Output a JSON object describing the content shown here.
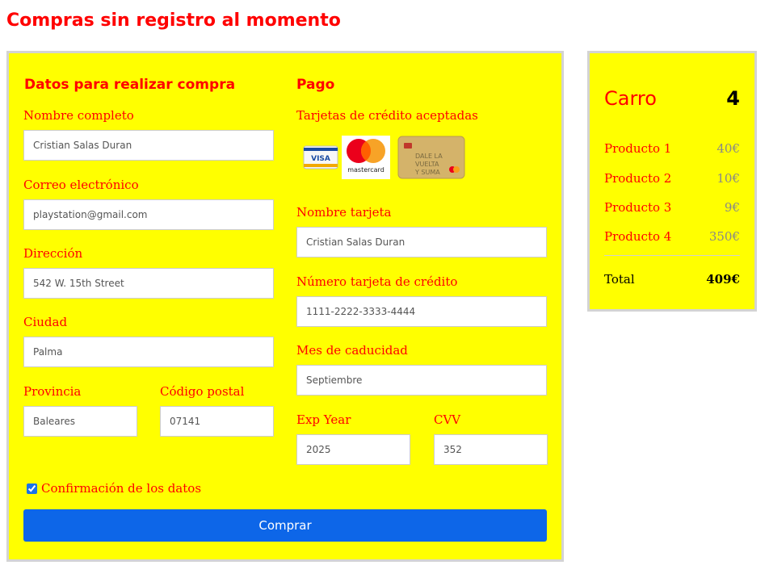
{
  "page": {
    "title": "Compras sin registro al momento"
  },
  "billing": {
    "heading": "Datos para realizar compra",
    "name_label": "Nombre completo",
    "name_value": "Cristian Salas Duran",
    "email_label": "Correo electrónico",
    "email_value": "playstation@gmail.com",
    "address_label": "Dirección",
    "address_value": "542 W. 15th Street",
    "city_label": "Ciudad",
    "city_value": "Palma",
    "province_label": "Provincia",
    "province_value": "Baleares",
    "zip_label": "Código postal",
    "zip_value": "07141"
  },
  "payment": {
    "heading": "Pago",
    "cards_label": "Tarjetas de crédito aceptadas",
    "card_icons": [
      "visa-card-icon",
      "mastercard-card-icon",
      "gold-card-icon"
    ],
    "card_texts": {
      "visa": "VISA",
      "mastercard": "mastercard",
      "gold_line1": "DALE LA",
      "gold_line2": "VUELTA",
      "gold_line3": "Y SUMA"
    },
    "card_name_label": "Nombre tarjeta",
    "card_name_value": "Cristian Salas Duran",
    "card_number_label": "Número tarjeta de crédito",
    "card_number_value": "1111-2222-3333-4444",
    "exp_month_label": "Mes de caducidad",
    "exp_month_value": "Septiembre",
    "exp_year_label": "Exp Year",
    "exp_year_value": "2025",
    "cvv_label": "CVV",
    "cvv_value": "352"
  },
  "confirm": {
    "label": "Confirmación de los datos",
    "checked": true
  },
  "submit": {
    "label": "Comprar"
  },
  "cart": {
    "title": "Carro",
    "count": "4",
    "items": [
      {
        "name": "Producto 1",
        "price": "40€"
      },
      {
        "name": "Producto 2",
        "price": "10€"
      },
      {
        "name": "Producto 3",
        "price": "9€"
      },
      {
        "name": "Producto 4",
        "price": "350€"
      }
    ],
    "total_label": "Total",
    "total_value": "409€"
  },
  "colors": {
    "accent": "#ff0000",
    "panel_bg": "#ffff00",
    "button_bg": "#0d66e8"
  }
}
